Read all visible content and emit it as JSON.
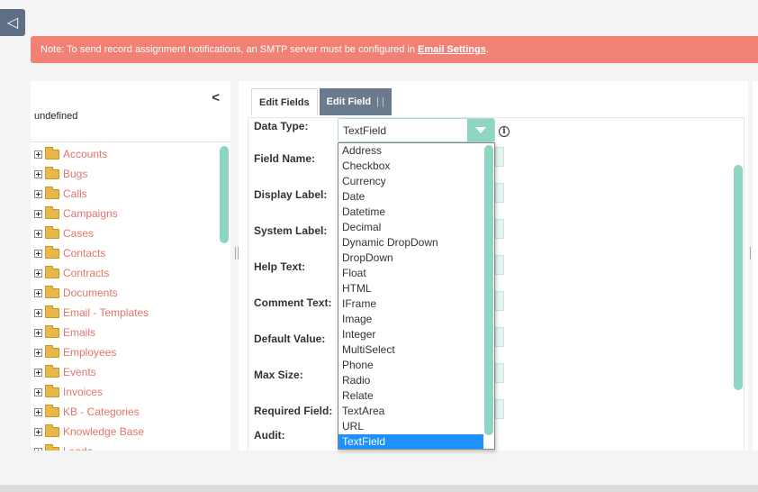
{
  "back_button": {
    "glyph": "◁"
  },
  "notice": {
    "prefix": "Note: To send record assignment notifications, an SMTP server must be configured in ",
    "link": "Email Settings",
    "suffix": "."
  },
  "left_panel": {
    "collapse_glyph": "<",
    "title": "undefined",
    "modules": [
      "Accounts",
      "Bugs",
      "Calls",
      "Campaigns",
      "Cases",
      "Contacts",
      "Contracts",
      "Documents",
      "Email - Templates",
      "Emails",
      "Employees",
      "Events",
      "Invoices",
      "KB - Categories",
      "Knowledge Base",
      "Leads"
    ]
  },
  "tabs": {
    "edit_fields": "Edit Fields",
    "edit_field": "Edit Field",
    "separator": "|  |"
  },
  "form": {
    "data_type": "Data Type:",
    "field_name": "Field Name:",
    "display_label": "Display Label:",
    "system_label": "System Label:",
    "help_text": "Help Text:",
    "comment_text": "Comment Text:",
    "default_value": "Default Value:",
    "max_size": "Max Size:",
    "required_field": "Required Field:",
    "audit": "Audit:"
  },
  "select": {
    "value": "TextField",
    "info_glyph": "i"
  },
  "dropdown_options": [
    "Address",
    "Checkbox",
    "Currency",
    "Date",
    "Datetime",
    "Decimal",
    "Dynamic DropDown",
    "DropDown",
    "Float",
    "HTML",
    "IFrame",
    "Image",
    "Integer",
    "MultiSelect",
    "Phone",
    "Radio",
    "Relate",
    "TextArea",
    "URL",
    "TextField"
  ],
  "colors": {
    "accent_teal": "#8fd5c4",
    "notice_bg": "#f08174",
    "link_red": "#e5736a",
    "selected_blue": "#1e90ff",
    "tab_active": "#6c7a8d"
  }
}
